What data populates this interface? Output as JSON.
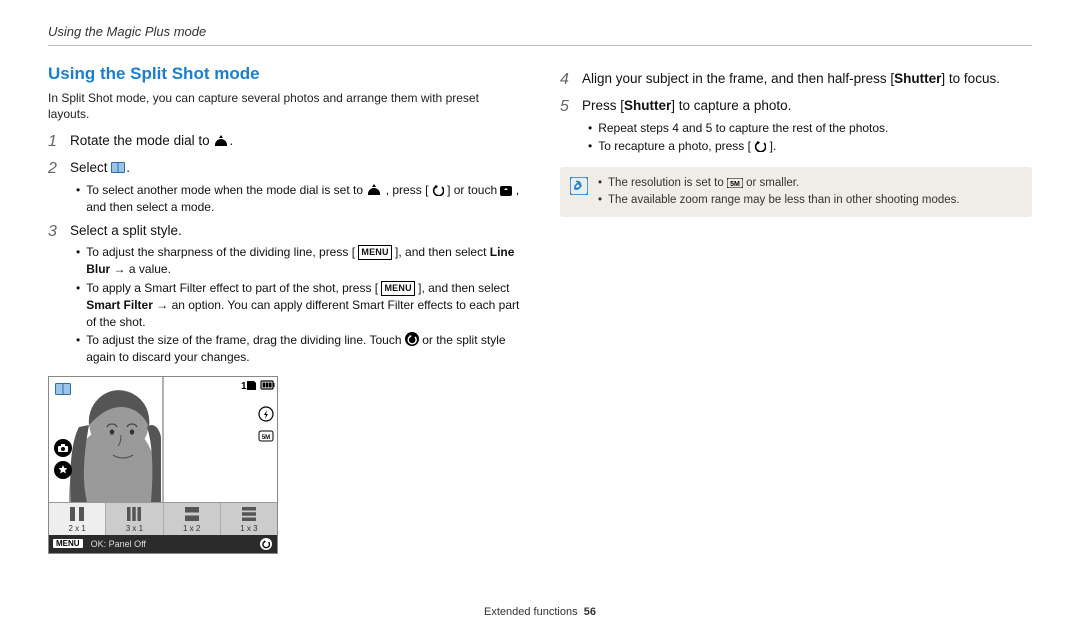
{
  "header": {
    "title": "Using the Magic Plus mode"
  },
  "left": {
    "sectionTitle": "Using the Split Shot mode",
    "intro": "In Split Shot mode, you can capture several photos and arrange them with preset layouts.",
    "step1": {
      "num": "1",
      "text": "Rotate the mode dial to "
    },
    "step2": {
      "num": "2",
      "text": "Select ",
      "sub1_a": "To select another mode when the mode dial is set to ",
      "sub1_b": ", press [",
      "sub1_c": "] or touch ",
      "sub1_d": ", and then select a mode."
    },
    "step3": {
      "num": "3",
      "text": "Select a split style.",
      "sub1_a": "To adjust the sharpness of the dividing line, press [",
      "sub1_b": "], and then select ",
      "sub1_bold": "Line Blur",
      "sub1_c": " → a value.",
      "sub2_a": "To apply a Smart Filter effect to part of the shot, press [",
      "sub2_b": "], and then select ",
      "sub2_bold": "Smart Filter",
      "sub2_c": " → an option. You can apply different Smart Filter effects to each part of the shot.",
      "sub3_a": "To adjust the size of the frame, drag the dividing line. Touch ",
      "sub3_b": " or the split style again to discard your changes."
    },
    "screen": {
      "count": "1",
      "styles": [
        "2 x 1",
        "3 x 1",
        "1 x 2",
        "1 x 3"
      ],
      "bottomMenu": "MENU",
      "bottomOk": "OK: Panel Off"
    }
  },
  "right": {
    "step4": {
      "num": "4",
      "text_a": "Align your subject in the frame, and then half-press [",
      "bold": "Shutter",
      "text_b": "] to focus."
    },
    "step5": {
      "num": "5",
      "text_a": "Press [",
      "bold": "Shutter",
      "text_b": "] to capture a photo.",
      "sub1": "Repeat steps 4 and 5 to capture the rest of the photos.",
      "sub2_a": "To recapture a photo, press [",
      "sub2_b": "]."
    },
    "note": {
      "line1_a": "The resolution is set to ",
      "line1_b": " or smaller.",
      "line2": "The available zoom range may be less than in other shooting modes."
    }
  },
  "footer": {
    "label": "Extended functions",
    "page": "56"
  }
}
